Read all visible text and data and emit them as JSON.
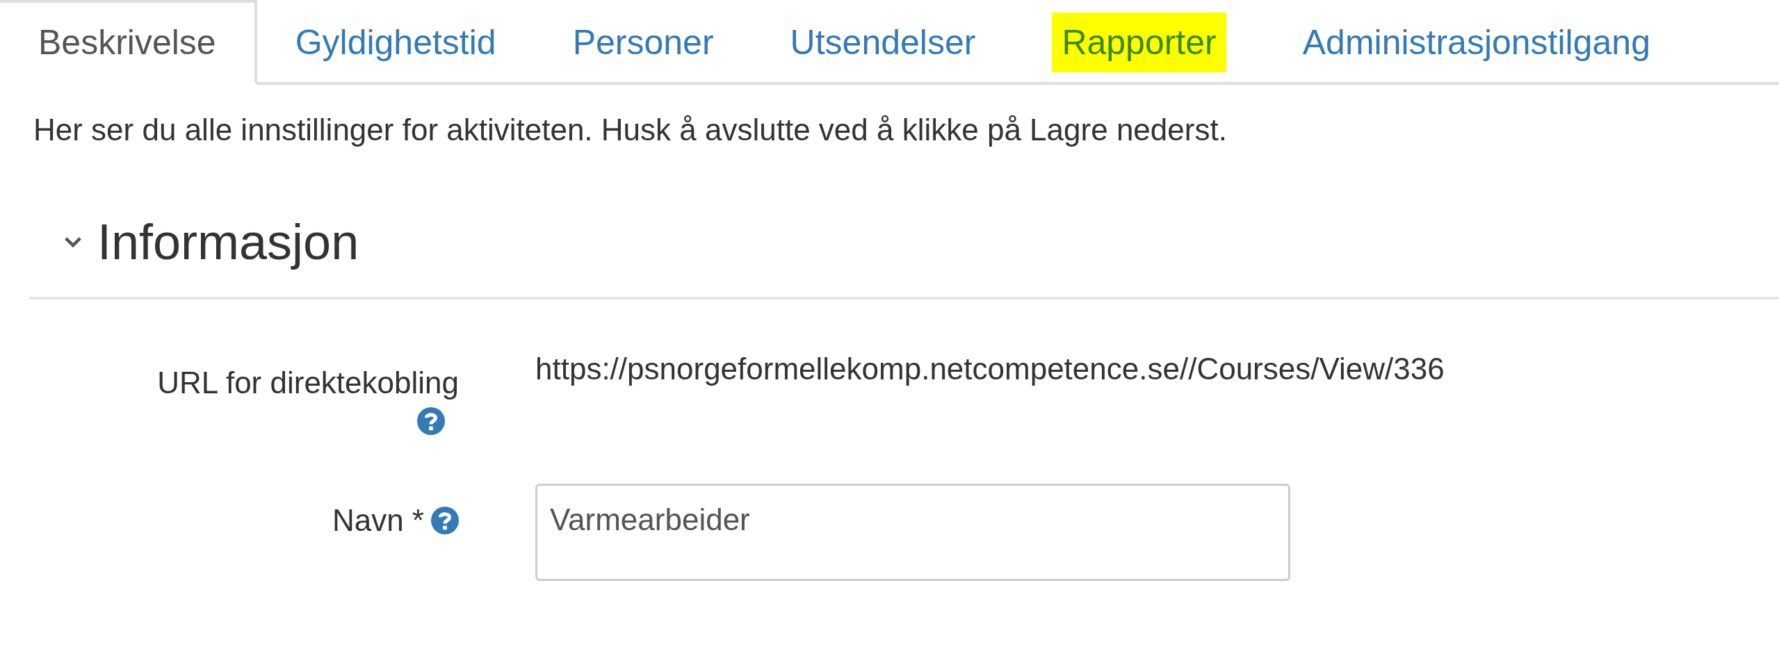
{
  "tabs": [
    {
      "label": "Beskrivelse",
      "selected": true,
      "highlighted": false
    },
    {
      "label": "Gyldighetstid",
      "selected": false,
      "highlighted": false
    },
    {
      "label": "Personer",
      "selected": false,
      "highlighted": false
    },
    {
      "label": "Utsendelser",
      "selected": false,
      "highlighted": false
    },
    {
      "label": "Rapporter",
      "selected": false,
      "highlighted": true
    },
    {
      "label": "Administrasjonstilgang",
      "selected": false,
      "highlighted": false
    }
  ],
  "intro": "Her ser du alle innstillinger for aktiviteten. Husk å avslutte ved å klikke på Lagre nederst.",
  "section": {
    "title": "Informasjon",
    "expanded": true
  },
  "fields": [
    {
      "kind": "text",
      "label": "URL for direktekobling",
      "value": "https://psnorgeformellekomp.netcompetence.se//Courses/View/336"
    },
    {
      "kind": "input",
      "label": "Navn *",
      "value": "Varmearbeider"
    }
  ]
}
